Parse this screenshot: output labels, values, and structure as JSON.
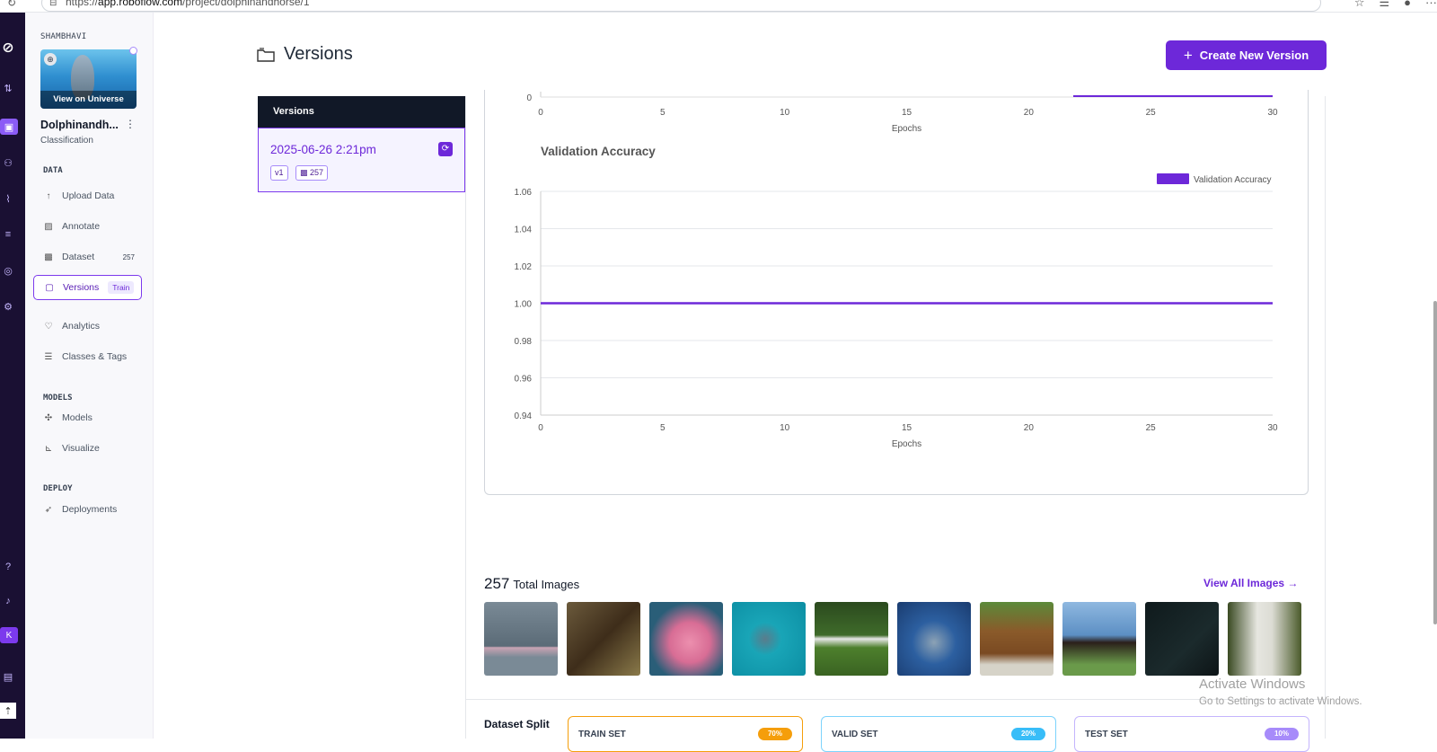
{
  "browser": {
    "url_prefix": "https://",
    "url_domain": "app.roboflow.com",
    "url_path": "/project/dolphinandhorse/1"
  },
  "sidebar": {
    "workspace": "SHAMBHAVI",
    "thumbnail_label": "View on Universe",
    "project_name": "Dolphinandh...",
    "project_type": "Classification",
    "sections": {
      "data": "DATA",
      "models": "MODELS",
      "deploy": "DEPLOY"
    },
    "items": {
      "upload": "Upload Data",
      "annotate": "Annotate",
      "dataset": "Dataset",
      "dataset_count": "257",
      "versions": "Versions",
      "versions_pill": "Train",
      "analytics": "Analytics",
      "classes": "Classes & Tags",
      "models": "Models",
      "visualize": "Visualize",
      "deployments": "Deployments"
    },
    "rail_avatar": "K"
  },
  "header": {
    "title": "Versions",
    "create_button": "Create New Version"
  },
  "versions_panel": {
    "heading": "Versions",
    "card": {
      "date": "2025-06-26 2:21pm",
      "version_tag": "v1",
      "image_count": "257"
    }
  },
  "chart_data": [
    {
      "type": "line",
      "partial": true,
      "xlabel": "Epochs",
      "x_ticks": [
        0,
        5,
        10,
        15,
        20,
        25,
        30
      ],
      "y_ticks": [
        "0"
      ]
    },
    {
      "type": "line",
      "title": "Validation Accuracy",
      "xlabel": "Epochs",
      "ylabel": "",
      "xlim": [
        0,
        30
      ],
      "ylim": [
        0.94,
        1.06
      ],
      "x_ticks": [
        0,
        5,
        10,
        15,
        20,
        25,
        30
      ],
      "y_ticks": [
        "0.94",
        "0.96",
        "0.98",
        "1.00",
        "1.02",
        "1.04",
        "1.06"
      ],
      "legend_position": "top-right",
      "grid": true,
      "series": [
        {
          "name": "Validation Accuracy",
          "color": "#6d28d9",
          "x": [
            0,
            30
          ],
          "values": [
            1.0,
            1.0
          ]
        }
      ]
    }
  ],
  "images": {
    "total": "257",
    "total_label": "Total Images",
    "view_all": "View All Images →",
    "thumbnails": [
      "pink dolphin in water",
      "brown horse in grass",
      "pink dolphin close-up",
      "dolphin in turquoise water",
      "white horse in field",
      "dolphin leaping",
      "chestnut horse",
      "black horse rearing",
      "dark underwater",
      "white horse in forest"
    ]
  },
  "split": {
    "label": "Dataset Split",
    "train": {
      "label": "TRAIN SET",
      "pct": "70%",
      "color": "#f59e0b"
    },
    "valid": {
      "label": "VALID SET",
      "pct": "20%",
      "color": "#38bdf8"
    },
    "test": {
      "label": "TEST SET",
      "pct": "10%",
      "color": "#a78bfa"
    }
  },
  "watermark": {
    "line1": "Activate Windows",
    "line2": "Go to Settings to activate Windows."
  }
}
